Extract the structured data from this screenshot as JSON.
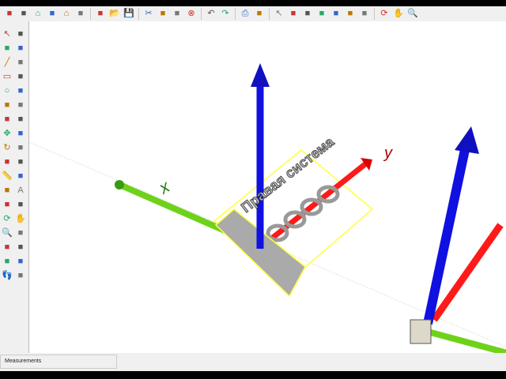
{
  "toolbar": {
    "icons": [
      "get-models-icon",
      "components-icon",
      "home-icon",
      "front-view-icon",
      "house-icon",
      "top-view-icon",
      "new-icon",
      "open-icon",
      "save-icon",
      "cut-icon",
      "copy-icon",
      "paste-icon",
      "erase-icon",
      "undo-icon",
      "redo-icon",
      "print-icon",
      "model-info-icon",
      "select-icon",
      "xray-icon",
      "wireframe-icon",
      "hidden-line-icon",
      "shaded-icon",
      "textured-icon",
      "monochrome-icon",
      "orbit-icon",
      "pan-icon",
      "zoom-icon"
    ]
  },
  "left_toolbar": {
    "icons": [
      "select-icon",
      "make-component-icon",
      "paint-bucket-icon",
      "eraser-icon",
      "line-icon",
      "freehand-icon",
      "rectangle-icon",
      "rotated-rectangle-icon",
      "circle-icon",
      "polygon-icon",
      "arc-icon",
      "pie-icon",
      "two-point-arc-icon",
      "three-point-arc-icon",
      "move-icon",
      "push-pull-icon",
      "rotate-icon",
      "follow-me-icon",
      "scale-icon",
      "offset-icon",
      "tape-measure-icon",
      "dimension-icon",
      "protractor-icon",
      "text-icon",
      "axes-icon",
      "3d-text-icon",
      "orbit-icon",
      "pan-icon",
      "zoom-icon",
      "zoom-window-icon",
      "zoom-extents-icon",
      "previous-view-icon",
      "position-camera-icon",
      "look-around-icon",
      "walk-icon",
      "section-plane-icon"
    ]
  },
  "scene": {
    "label_3d": "Правая система",
    "axis_x_label": "x",
    "axis_y_label": "y",
    "colors": {
      "x": "#ff1a1a",
      "y": "#1010e0",
      "green": "#6fd21a",
      "selection": "#ffff40"
    }
  },
  "status": {
    "measurements_label": "Measurements"
  }
}
